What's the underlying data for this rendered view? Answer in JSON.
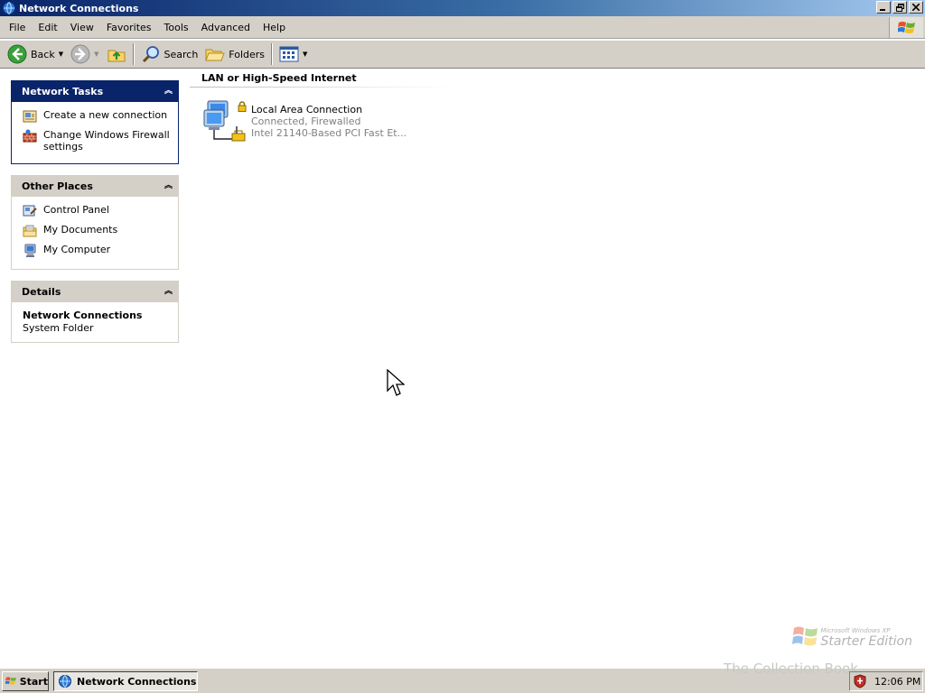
{
  "window": {
    "title": "Network Connections",
    "controls": [
      "minimize",
      "restore",
      "close"
    ]
  },
  "menu": {
    "items": [
      "File",
      "Edit",
      "View",
      "Favorites",
      "Tools",
      "Advanced",
      "Help"
    ]
  },
  "toolbar": {
    "back_label": "Back",
    "search_label": "Search",
    "folders_label": "Folders"
  },
  "task_pane": {
    "network_tasks": {
      "title": "Network Tasks",
      "items": [
        {
          "label": "Create a new connection",
          "icon": "new-connection-icon"
        },
        {
          "label": "Change Windows Firewall settings",
          "icon": "firewall-icon"
        }
      ]
    },
    "other_places": {
      "title": "Other Places",
      "items": [
        {
          "label": "Control Panel",
          "icon": "control-panel-icon"
        },
        {
          "label": "My Documents",
          "icon": "my-documents-icon"
        },
        {
          "label": "My Computer",
          "icon": "my-computer-icon"
        }
      ]
    },
    "details": {
      "title": "Details",
      "name": "Network Connections",
      "type": "System Folder"
    }
  },
  "content": {
    "group_header": "LAN or High-Speed Internet",
    "connections": [
      {
        "name": "Local Area Connection",
        "status": "Connected, Firewalled",
        "device": "Intel 21140-Based PCI Fast Et..."
      }
    ]
  },
  "watermark": {
    "line1": "Microsoft Windows XP",
    "line2": "Starter Edition"
  },
  "taskbar": {
    "start_label": "Start",
    "active_window": "Network Connections",
    "clock": "12:06 PM",
    "overlay_text": "The Collection Book"
  },
  "colors": {
    "title_gradient_start": "#0a246a",
    "title_gradient_end": "#a6caf0",
    "special_panel_header": "#0a246a",
    "chrome": "#d4d0c8",
    "secondary_text": "#808080"
  }
}
